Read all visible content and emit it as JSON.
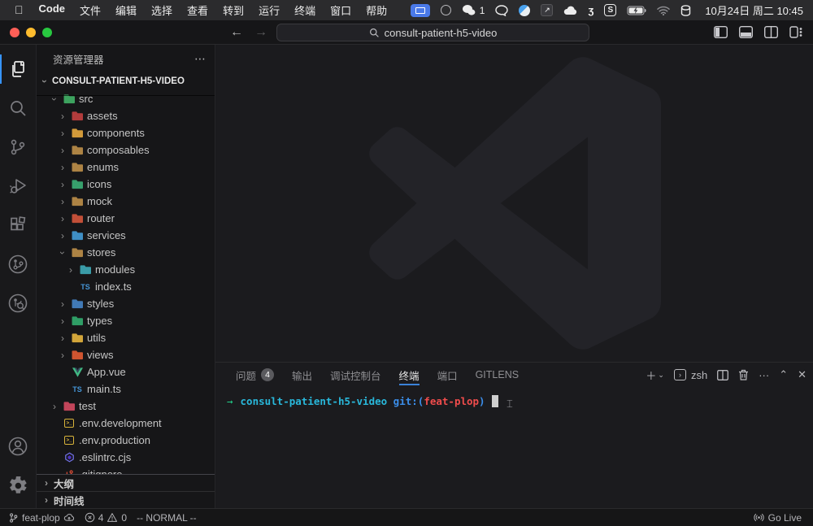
{
  "menubar": {
    "apple": "",
    "items": [
      "Code",
      "文件",
      "编辑",
      "选择",
      "查看",
      "转到",
      "运行",
      "终端",
      "窗口",
      "帮助"
    ],
    "wechat_badge": "1",
    "datetime": "10月24日 周二 10:45"
  },
  "titlebar": {
    "search_text": "consult-patient-h5-video"
  },
  "sidebar": {
    "title": "资源管理器",
    "more_label": "⋯",
    "project": "CONSULT-PATIENT-H5-VIDEO",
    "tree": [
      {
        "label": "src",
        "level": 1,
        "kind": "folder",
        "color": "#3da35f",
        "expanded": true
      },
      {
        "label": "assets",
        "level": 2,
        "kind": "folder",
        "color": "#b23c3c"
      },
      {
        "label": "components",
        "level": 2,
        "kind": "folder",
        "color": "#d29a3a"
      },
      {
        "label": "composables",
        "level": 2,
        "kind": "folder",
        "color": "#ad8344"
      },
      {
        "label": "enums",
        "level": 2,
        "kind": "folder",
        "color": "#ad8344"
      },
      {
        "label": "icons",
        "level": 2,
        "kind": "folder",
        "color": "#37a06c"
      },
      {
        "label": "mock",
        "level": 2,
        "kind": "folder",
        "color": "#ad8344"
      },
      {
        "label": "router",
        "level": 2,
        "kind": "folder",
        "color": "#c24f38"
      },
      {
        "label": "services",
        "level": 2,
        "kind": "folder",
        "color": "#3f8fc5"
      },
      {
        "label": "stores",
        "level": 2,
        "kind": "folder",
        "color": "#ad8344",
        "expanded": true
      },
      {
        "label": "modules",
        "level": 3,
        "kind": "folder",
        "color": "#3a9ca8"
      },
      {
        "label": "index.ts",
        "level": 3,
        "kind": "ts"
      },
      {
        "label": "styles",
        "level": 2,
        "kind": "folder",
        "color": "#4179b5"
      },
      {
        "label": "types",
        "level": 2,
        "kind": "folder",
        "color": "#2f9e66"
      },
      {
        "label": "utils",
        "level": 2,
        "kind": "folder",
        "color": "#d2a53a"
      },
      {
        "label": "views",
        "level": 2,
        "kind": "folder",
        "color": "#cf5430"
      },
      {
        "label": "App.vue",
        "level": 2,
        "kind": "vue"
      },
      {
        "label": "main.ts",
        "level": 2,
        "kind": "ts"
      },
      {
        "label": "test",
        "level": 1,
        "kind": "folder",
        "color": "#c2455a"
      },
      {
        "label": ".env.development",
        "level": 1,
        "kind": "env"
      },
      {
        "label": ".env.production",
        "level": 1,
        "kind": "env"
      },
      {
        "label": ".eslintrc.cjs",
        "level": 1,
        "kind": "eslint"
      },
      {
        "label": ".gitignore",
        "level": 1,
        "kind": "git"
      }
    ],
    "outline": "大纲",
    "timeline": "时间线"
  },
  "panel": {
    "tabs": [
      {
        "label": "问题",
        "badge": "4"
      },
      {
        "label": "输出"
      },
      {
        "label": "调试控制台"
      },
      {
        "label": "终端",
        "active": true
      },
      {
        "label": "端口"
      },
      {
        "label": "GITLENS"
      }
    ],
    "shell_label": "zsh",
    "terminal": {
      "arrow": "→",
      "cwd": "consult-patient-h5-video",
      "git_prefix": " git:(",
      "branch": "feat-plop",
      "git_suffix": ")"
    }
  },
  "statusbar": {
    "branch": "feat-plop",
    "errors": "4",
    "warnings": "0",
    "mode": "-- NORMAL --",
    "golive": "Go Live"
  },
  "colors": {
    "accent_blue": "#3b82d8",
    "terminal_green": "#23d18b",
    "terminal_cyan": "#29b8db",
    "terminal_blue": "#3b8eea",
    "terminal_red": "#f14c4c"
  }
}
